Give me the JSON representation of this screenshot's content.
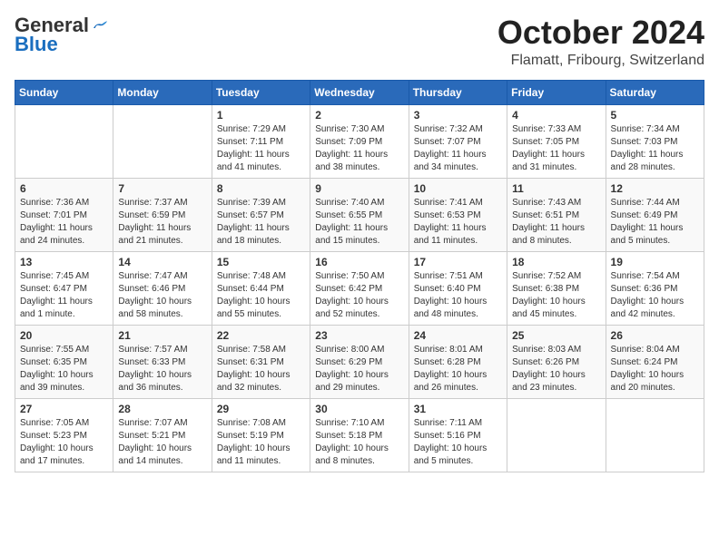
{
  "header": {
    "logo_general": "General",
    "logo_blue": "Blue",
    "month_title": "October 2024",
    "location": "Flamatt, Fribourg, Switzerland"
  },
  "weekdays": [
    "Sunday",
    "Monday",
    "Tuesday",
    "Wednesday",
    "Thursday",
    "Friday",
    "Saturday"
  ],
  "weeks": [
    [
      {
        "day": null,
        "info": null
      },
      {
        "day": null,
        "info": null
      },
      {
        "day": "1",
        "info": "Sunrise: 7:29 AM\nSunset: 7:11 PM\nDaylight: 11 hours\nand 41 minutes."
      },
      {
        "day": "2",
        "info": "Sunrise: 7:30 AM\nSunset: 7:09 PM\nDaylight: 11 hours\nand 38 minutes."
      },
      {
        "day": "3",
        "info": "Sunrise: 7:32 AM\nSunset: 7:07 PM\nDaylight: 11 hours\nand 34 minutes."
      },
      {
        "day": "4",
        "info": "Sunrise: 7:33 AM\nSunset: 7:05 PM\nDaylight: 11 hours\nand 31 minutes."
      },
      {
        "day": "5",
        "info": "Sunrise: 7:34 AM\nSunset: 7:03 PM\nDaylight: 11 hours\nand 28 minutes."
      }
    ],
    [
      {
        "day": "6",
        "info": "Sunrise: 7:36 AM\nSunset: 7:01 PM\nDaylight: 11 hours\nand 24 minutes."
      },
      {
        "day": "7",
        "info": "Sunrise: 7:37 AM\nSunset: 6:59 PM\nDaylight: 11 hours\nand 21 minutes."
      },
      {
        "day": "8",
        "info": "Sunrise: 7:39 AM\nSunset: 6:57 PM\nDaylight: 11 hours\nand 18 minutes."
      },
      {
        "day": "9",
        "info": "Sunrise: 7:40 AM\nSunset: 6:55 PM\nDaylight: 11 hours\nand 15 minutes."
      },
      {
        "day": "10",
        "info": "Sunrise: 7:41 AM\nSunset: 6:53 PM\nDaylight: 11 hours\nand 11 minutes."
      },
      {
        "day": "11",
        "info": "Sunrise: 7:43 AM\nSunset: 6:51 PM\nDaylight: 11 hours\nand 8 minutes."
      },
      {
        "day": "12",
        "info": "Sunrise: 7:44 AM\nSunset: 6:49 PM\nDaylight: 11 hours\nand 5 minutes."
      }
    ],
    [
      {
        "day": "13",
        "info": "Sunrise: 7:45 AM\nSunset: 6:47 PM\nDaylight: 11 hours\nand 1 minute."
      },
      {
        "day": "14",
        "info": "Sunrise: 7:47 AM\nSunset: 6:46 PM\nDaylight: 10 hours\nand 58 minutes."
      },
      {
        "day": "15",
        "info": "Sunrise: 7:48 AM\nSunset: 6:44 PM\nDaylight: 10 hours\nand 55 minutes."
      },
      {
        "day": "16",
        "info": "Sunrise: 7:50 AM\nSunset: 6:42 PM\nDaylight: 10 hours\nand 52 minutes."
      },
      {
        "day": "17",
        "info": "Sunrise: 7:51 AM\nSunset: 6:40 PM\nDaylight: 10 hours\nand 48 minutes."
      },
      {
        "day": "18",
        "info": "Sunrise: 7:52 AM\nSunset: 6:38 PM\nDaylight: 10 hours\nand 45 minutes."
      },
      {
        "day": "19",
        "info": "Sunrise: 7:54 AM\nSunset: 6:36 PM\nDaylight: 10 hours\nand 42 minutes."
      }
    ],
    [
      {
        "day": "20",
        "info": "Sunrise: 7:55 AM\nSunset: 6:35 PM\nDaylight: 10 hours\nand 39 minutes."
      },
      {
        "day": "21",
        "info": "Sunrise: 7:57 AM\nSunset: 6:33 PM\nDaylight: 10 hours\nand 36 minutes."
      },
      {
        "day": "22",
        "info": "Sunrise: 7:58 AM\nSunset: 6:31 PM\nDaylight: 10 hours\nand 32 minutes."
      },
      {
        "day": "23",
        "info": "Sunrise: 8:00 AM\nSunset: 6:29 PM\nDaylight: 10 hours\nand 29 minutes."
      },
      {
        "day": "24",
        "info": "Sunrise: 8:01 AM\nSunset: 6:28 PM\nDaylight: 10 hours\nand 26 minutes."
      },
      {
        "day": "25",
        "info": "Sunrise: 8:03 AM\nSunset: 6:26 PM\nDaylight: 10 hours\nand 23 minutes."
      },
      {
        "day": "26",
        "info": "Sunrise: 8:04 AM\nSunset: 6:24 PM\nDaylight: 10 hours\nand 20 minutes."
      }
    ],
    [
      {
        "day": "27",
        "info": "Sunrise: 7:05 AM\nSunset: 5:23 PM\nDaylight: 10 hours\nand 17 minutes."
      },
      {
        "day": "28",
        "info": "Sunrise: 7:07 AM\nSunset: 5:21 PM\nDaylight: 10 hours\nand 14 minutes."
      },
      {
        "day": "29",
        "info": "Sunrise: 7:08 AM\nSunset: 5:19 PM\nDaylight: 10 hours\nand 11 minutes."
      },
      {
        "day": "30",
        "info": "Sunrise: 7:10 AM\nSunset: 5:18 PM\nDaylight: 10 hours\nand 8 minutes."
      },
      {
        "day": "31",
        "info": "Sunrise: 7:11 AM\nSunset: 5:16 PM\nDaylight: 10 hours\nand 5 minutes."
      },
      {
        "day": null,
        "info": null
      },
      {
        "day": null,
        "info": null
      }
    ]
  ]
}
